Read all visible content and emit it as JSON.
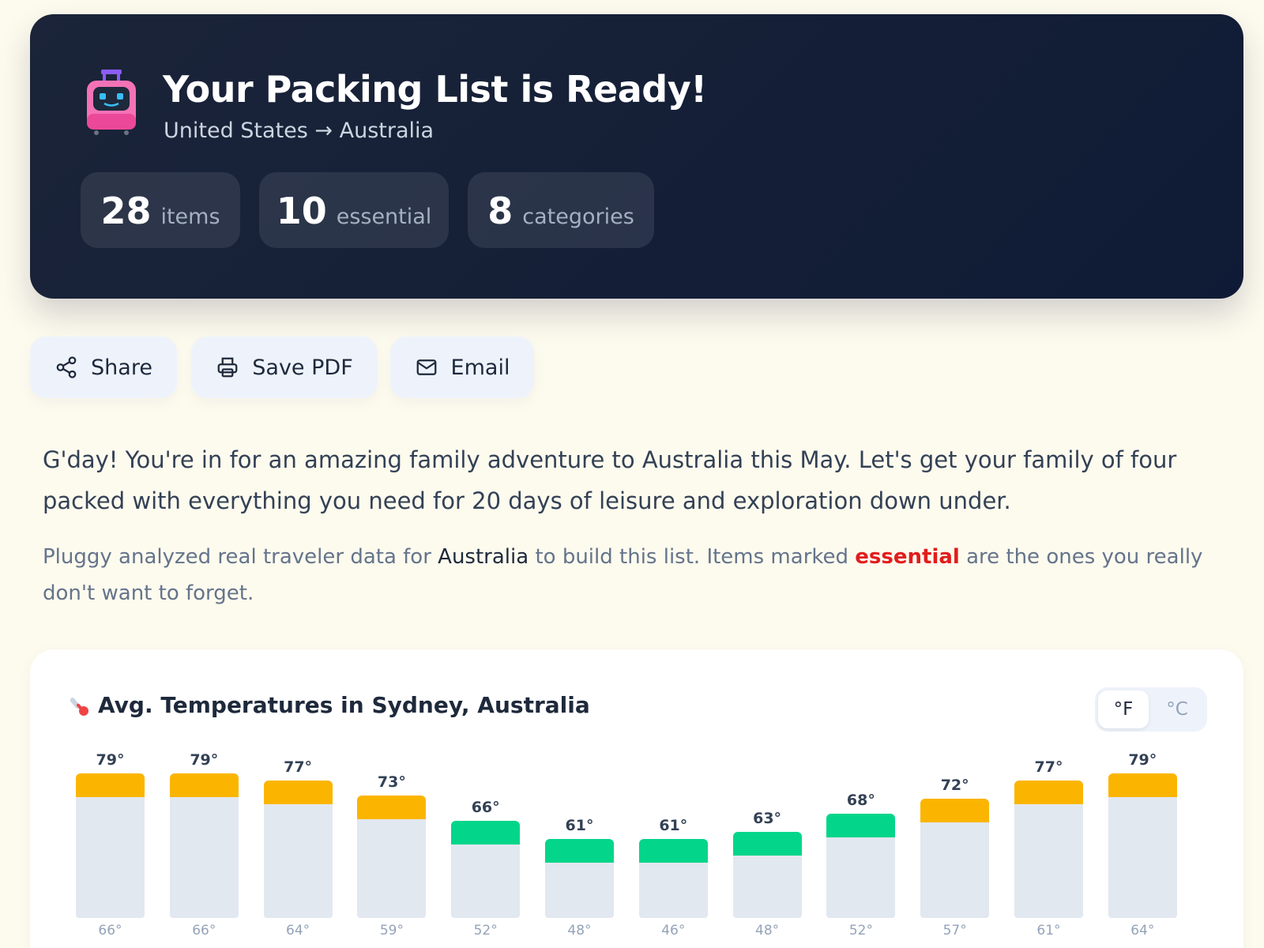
{
  "hero": {
    "title": "Your Packing List is Ready!",
    "subtitle": "United States → Australia",
    "icon": "luggage-robot-icon",
    "stats": [
      {
        "value": "28",
        "label": "items"
      },
      {
        "value": "10",
        "label": "essential"
      },
      {
        "value": "8",
        "label": "categories"
      }
    ]
  },
  "actions": {
    "share": {
      "label": "Share",
      "icon": "share-icon"
    },
    "save_pdf": {
      "label": "Save PDF",
      "icon": "printer-icon"
    },
    "email": {
      "label": "Email",
      "icon": "mail-icon"
    }
  },
  "intro": "G'day! You're in for an amazing family adventure to Australia this May. Let's get your family of four packed with everything you need for 20 days of leisure and exploration down under.",
  "note": {
    "part1": "Pluggy analyzed real traveler data for ",
    "country": "Australia",
    "part2": " to build this list. Items marked ",
    "essential": "essential",
    "part3": " are the ones you really don't want to forget."
  },
  "weather": {
    "title": "Avg. Temperatures in Sydney, Australia",
    "icon": "thermometer-icon",
    "unit_f": "°F",
    "unit_c": "°C",
    "selected_unit": "°F"
  },
  "colors": {
    "warm": "#fbb500",
    "mild": "#03d68a",
    "track": "#e2e8f0",
    "essential": "#e11d1d"
  },
  "chart_data": {
    "type": "bar",
    "highs": [
      79,
      79,
      77,
      73,
      66,
      61,
      61,
      63,
      68,
      72,
      77,
      79
    ],
    "lows": [
      66,
      66,
      64,
      59,
      52,
      48,
      46,
      48,
      52,
      57,
      61,
      64
    ],
    "high_labels": [
      "79°",
      "79°",
      "77°",
      "73°",
      "66°",
      "61°",
      "61°",
      "63°",
      "68°",
      "72°",
      "77°",
      "79°"
    ],
    "low_labels": [
      "66°",
      "66°",
      "64°",
      "59°",
      "52°",
      "48°",
      "46°",
      "48°",
      "52°",
      "57°",
      "61°",
      "64°"
    ],
    "high_color_class": [
      "warm",
      "warm",
      "warm",
      "warm",
      "mild",
      "mild",
      "mild",
      "mild",
      "mild",
      "warm",
      "warm",
      "warm"
    ]
  }
}
